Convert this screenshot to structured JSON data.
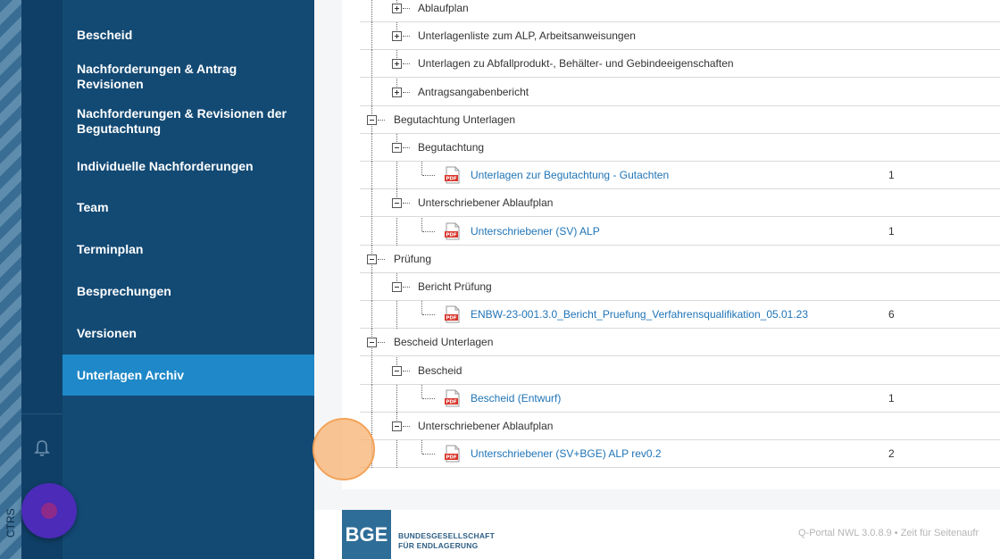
{
  "sidebar": {
    "items": [
      {
        "label": "Bescheid"
      },
      {
        "label": "Nachforderungen & Antrag Revisionen"
      },
      {
        "label": "Nachforderungen & Revisionen der Begutachtung"
      },
      {
        "label": "Individuelle Nachforderungen"
      },
      {
        "label": "Team"
      },
      {
        "label": "Terminplan"
      },
      {
        "label": "Besprechungen"
      },
      {
        "label": "Versionen"
      },
      {
        "label": "Unterlagen Archiv",
        "active": true
      }
    ],
    "ctrs_label": "CTRS"
  },
  "tree": [
    {
      "level": 1,
      "expander": "plus",
      "label": "Ablaufplan"
    },
    {
      "level": 1,
      "expander": "plus",
      "label": "Unterlagenliste zum ALP, Arbeitsanweisungen"
    },
    {
      "level": 1,
      "expander": "plus",
      "label": "Unterlagen zu Abfallprodukt-, Behälter- und Gebindeeigenschaften"
    },
    {
      "level": 1,
      "expander": "plus",
      "label": "Antragsangabenbericht"
    },
    {
      "level": 0,
      "expander": "minus",
      "label": "Begutachtung Unterlagen"
    },
    {
      "level": 1,
      "expander": "minus",
      "label": "Begutachtung"
    },
    {
      "level": 2,
      "file": true,
      "label": "Unterlagen zur Begutachtung - Gutachten",
      "count": "1"
    },
    {
      "level": 1,
      "expander": "minus",
      "label": "Unterschriebener Ablaufplan"
    },
    {
      "level": 2,
      "file": true,
      "label": "Unterschriebener (SV) ALP",
      "count": "1"
    },
    {
      "level": 0,
      "expander": "minus",
      "label": "Prüfung"
    },
    {
      "level": 1,
      "expander": "minus",
      "label": "Bericht Prüfung"
    },
    {
      "level": 2,
      "file": true,
      "label": "ENBW-23-001.3.0_Bericht_Pruefung_Verfahrensqualifikation_05.01.23",
      "count": "6"
    },
    {
      "level": 0,
      "expander": "minus",
      "label": "Bescheid Unterlagen"
    },
    {
      "level": 1,
      "expander": "minus",
      "label": "Bescheid"
    },
    {
      "level": 2,
      "file": true,
      "label": "Bescheid (Entwurf)",
      "count": "1"
    },
    {
      "level": 1,
      "expander": "minus",
      "label": "Unterschriebener Ablaufplan"
    },
    {
      "level": 2,
      "file": true,
      "label": "Unterschriebener (SV+BGE) ALP rev0.2",
      "count": "2"
    }
  ],
  "file_icon_label": "PDF",
  "footer": {
    "logo_abbr": "BGE",
    "logo_line1": "BUNDESGESELLSCHAFT",
    "logo_line2": "FÜR ENDLAGERUNG",
    "version_text": "Q-Portal NWL 3.0.8.9  •  Zeit für Seitenaufr"
  },
  "colors": {
    "sidebar_bg": "#134a74",
    "active_item": "#1e88c8",
    "link": "#1f74b7",
    "fab": "#4b2bb8"
  }
}
